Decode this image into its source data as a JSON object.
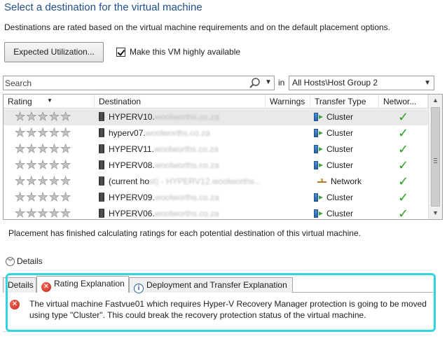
{
  "page": {
    "title": "Select a destination for the virtual machine",
    "description": "Destinations are rated based on the virtual machine requirements and on the default placement options."
  },
  "toolbar": {
    "expected_utilization_label": "Expected Utilization...",
    "highly_available_label": "Make this VM highly available",
    "highly_available_checked": true
  },
  "search": {
    "placeholder": "Search",
    "in_label": "in",
    "scope_value": "All Hosts\\Host Group 2"
  },
  "grid": {
    "columns": [
      "Rating",
      "Destination",
      "Warnings",
      "Transfer Type",
      "Networ..."
    ],
    "rows": [
      {
        "stars": "★★★★★",
        "dest": "HYPERV10.",
        "dest_blurred": "woolworths.co.za",
        "type": "Cluster"
      },
      {
        "stars": "★★★★★",
        "dest": "hyperv07.",
        "dest_blurred": "woolworths.co.za",
        "type": "Cluster"
      },
      {
        "stars": "★★★★★",
        "dest": "HYPERV11.",
        "dest_blurred": "woolworths.co.za",
        "type": "Cluster"
      },
      {
        "stars": "★★★★★",
        "dest": "HYPERV08.",
        "dest_blurred": "woolworths.co.za",
        "type": "Cluster"
      },
      {
        "stars": "★★★★★",
        "dest": "(current ho",
        "dest_blurred": "st) - HYPERV12.woolworths...",
        "type": "Network"
      },
      {
        "stars": "★★★★★",
        "dest": "HYPERV09.",
        "dest_blurred": "woolworths.co.za",
        "type": "Cluster"
      },
      {
        "stars": "★★★★★",
        "dest": "HYPERV06.",
        "dest_blurred": "woolworths.co.za",
        "type": "Cluster"
      }
    ],
    "network_ok_glyph": "✓"
  },
  "status_text": "Placement has finished calculating ratings for each potential destination of this virtual machine.",
  "details": {
    "toggle_label": "Details",
    "tabs": [
      "Details",
      "Rating Explanation",
      "Deployment and Transfer Explanation"
    ],
    "active_tab": 1,
    "message": "The virtual machine Fastvue01 which requires Hyper-V Recovery Manager protection is going to be moved using type \"Cluster\". This could break the recovery protection status of the virtual machine."
  },
  "colors": {
    "title": "#1e4e8c",
    "highlight": "#2fd6e2",
    "ok_green": "#2aa01e",
    "error_red": "#c4261b"
  },
  "icons": {
    "search": "magnifier-icon",
    "server": "server-icon",
    "cluster": "cluster-transfer-icon",
    "network": "network-transfer-icon",
    "error": "error-icon",
    "info": "info-icon"
  }
}
